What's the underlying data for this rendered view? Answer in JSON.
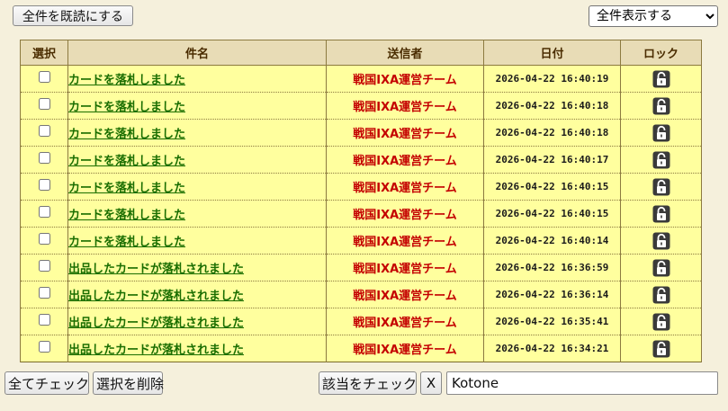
{
  "toolbar": {
    "mark_all_read_label": "全件を既読にする",
    "filter_selected": "全件表示する"
  },
  "table": {
    "headers": {
      "select": "選択",
      "subject": "件名",
      "sender": "送信者",
      "date": "日付",
      "lock": "ロック"
    },
    "rows": [
      {
        "subject": "カードを落札しました",
        "sender": "戦国IXA運営チーム",
        "date": "2026-04-22 16:40:19",
        "checked": false,
        "locked": false
      },
      {
        "subject": "カードを落札しました",
        "sender": "戦国IXA運営チーム",
        "date": "2026-04-22 16:40:18",
        "checked": false,
        "locked": false
      },
      {
        "subject": "カードを落札しました",
        "sender": "戦国IXA運営チーム",
        "date": "2026-04-22 16:40:18",
        "checked": false,
        "locked": false
      },
      {
        "subject": "カードを落札しました",
        "sender": "戦国IXA運営チーム",
        "date": "2026-04-22 16:40:17",
        "checked": false,
        "locked": false
      },
      {
        "subject": "カードを落札しました",
        "sender": "戦国IXA運営チーム",
        "date": "2026-04-22 16:40:15",
        "checked": false,
        "locked": false
      },
      {
        "subject": "カードを落札しました",
        "sender": "戦国IXA運営チーム",
        "date": "2026-04-22 16:40:15",
        "checked": false,
        "locked": false
      },
      {
        "subject": "カードを落札しました",
        "sender": "戦国IXA運営チーム",
        "date": "2026-04-22 16:40:14",
        "checked": false,
        "locked": false
      },
      {
        "subject": "出品したカードが落札されました",
        "sender": "戦国IXA運営チーム",
        "date": "2026-04-22 16:36:59",
        "checked": false,
        "locked": false
      },
      {
        "subject": "出品したカードが落札されました",
        "sender": "戦国IXA運営チーム",
        "date": "2026-04-22 16:36:14",
        "checked": false,
        "locked": false
      },
      {
        "subject": "出品したカードが落札されました",
        "sender": "戦国IXA運営チーム",
        "date": "2026-04-22 16:35:41",
        "checked": false,
        "locked": false
      },
      {
        "subject": "出品したカードが落札されました",
        "sender": "戦国IXA運営チーム",
        "date": "2026-04-22 16:34:21",
        "checked": false,
        "locked": false
      }
    ]
  },
  "footer": {
    "check_all_label": "全てチェック",
    "delete_selected_label": "選択を削除",
    "check_match_label": "該当をチェック",
    "clear_label": "X",
    "name_value": "Kotone"
  },
  "icons": {
    "lock": "padlock-open-icon"
  },
  "colors": {
    "header_bg": "#e8dcb6",
    "row_bg": "#ffff9e",
    "subject": "#1a6e00",
    "sender": "#c40000"
  }
}
